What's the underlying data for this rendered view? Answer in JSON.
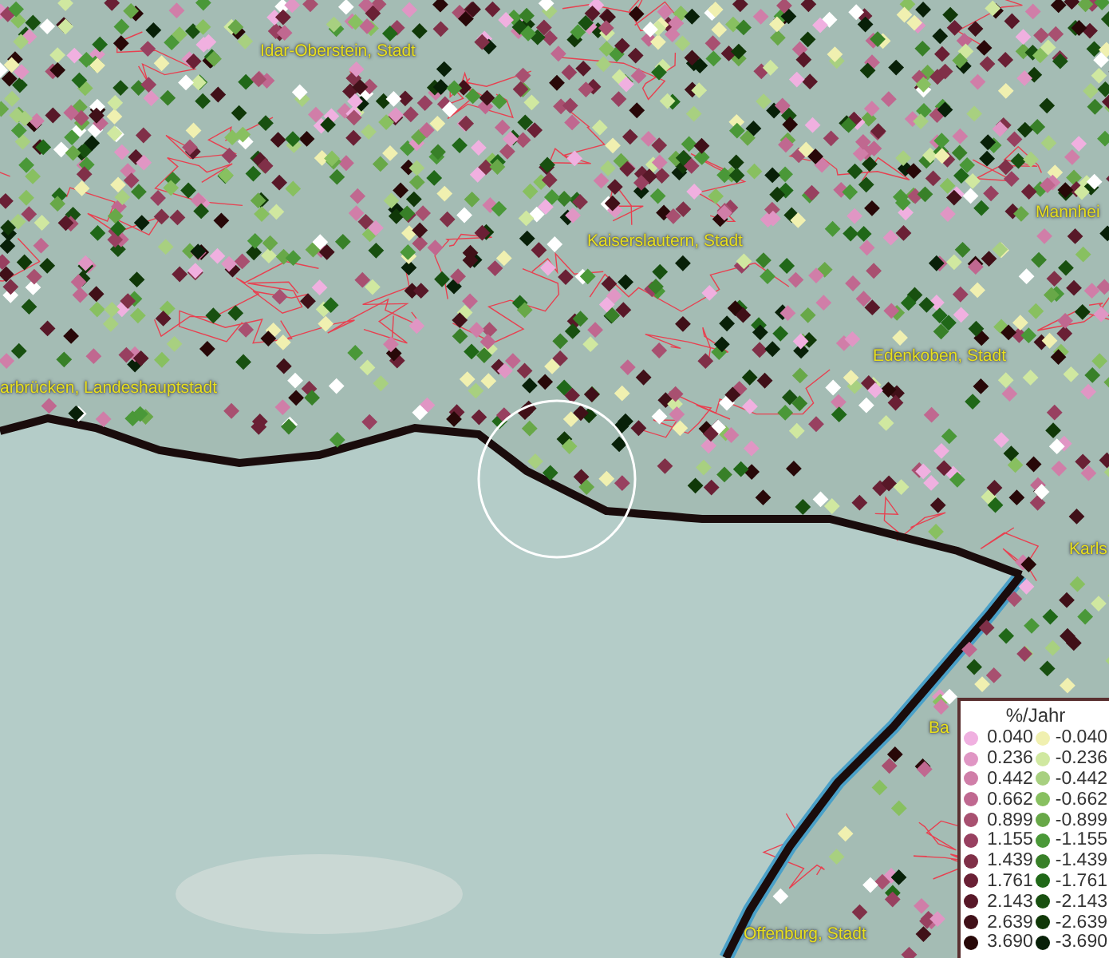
{
  "map": {
    "labels": [
      {
        "text": "Idar-Oberstein, Stadt"
      },
      {
        "text": "Kaiserslautern, Stadt"
      },
      {
        "text": "Mannhei"
      },
      {
        "text": "arbrücken, Landeshauptstadt"
      },
      {
        "text": "Edenkoben, Stadt"
      },
      {
        "text": "Karls"
      },
      {
        "text": "Ba"
      },
      {
        "text": "Offenburg, Stadt"
      }
    ]
  },
  "legend": {
    "title": "%/Jahr",
    "columns": [
      {
        "items": [
          {
            "value": "0.040",
            "color": "#f0b0e0"
          },
          {
            "value": "0.236",
            "color": "#e096c4"
          },
          {
            "value": "0.442",
            "color": "#d07ea8"
          },
          {
            "value": "0.662",
            "color": "#c06890"
          },
          {
            "value": "0.899",
            "color": "#a85070"
          },
          {
            "value": "1.155",
            "color": "#984060"
          },
          {
            "value": "1.439",
            "color": "#803048"
          },
          {
            "value": "1.761",
            "color": "#6a2035"
          },
          {
            "value": "2.143",
            "color": "#581828"
          },
          {
            "value": "2.639",
            "color": "#401018"
          },
          {
            "value": "3.690",
            "color": "#280808"
          }
        ]
      },
      {
        "items": [
          {
            "value": "-0.040",
            "color": "#f0f0b0"
          },
          {
            "value": "-0.236",
            "color": "#d0e8a0"
          },
          {
            "value": "-0.442",
            "color": "#a8d080"
          },
          {
            "value": "-0.662",
            "color": "#88c060"
          },
          {
            "value": "-0.899",
            "color": "#68a848"
          },
          {
            "value": "-1.155",
            "color": "#4a9838"
          },
          {
            "value": "-1.439",
            "color": "#388028"
          },
          {
            "value": "-1.761",
            "color": "#206818"
          },
          {
            "value": "-2.143",
            "color": "#185010"
          },
          {
            "value": "-2.639",
            "color": "#103808"
          },
          {
            "value": "-3.690",
            "color": "#082008"
          }
        ]
      }
    ]
  }
}
